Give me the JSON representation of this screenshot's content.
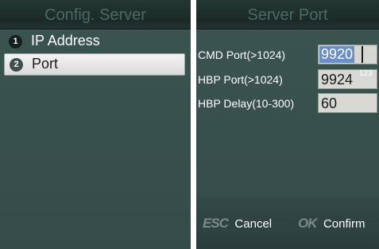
{
  "left_screen": {
    "title": "Config. Server",
    "menu": [
      {
        "num": "1",
        "label": "IP Address"
      },
      {
        "num": "2",
        "label": "Port"
      }
    ]
  },
  "right_screen": {
    "title": "Server Port",
    "fields": [
      {
        "label": "CMD Port(>1024)",
        "value": "9920"
      },
      {
        "label": "HBP Port(>1024)",
        "value": "9924",
        "ime_indicator": "123"
      },
      {
        "label": "HBP Delay(10-300)",
        "value": "60"
      }
    ],
    "softkeys": {
      "esc_icon": "ESC",
      "cancel_label": "Cancel",
      "ok_icon": "OK",
      "confirm_label": "Confirm"
    }
  },
  "colors": {
    "screen_bg": "#38504c",
    "title_bar": "#1b2a27",
    "selection_highlight": "#6a8ec6"
  }
}
